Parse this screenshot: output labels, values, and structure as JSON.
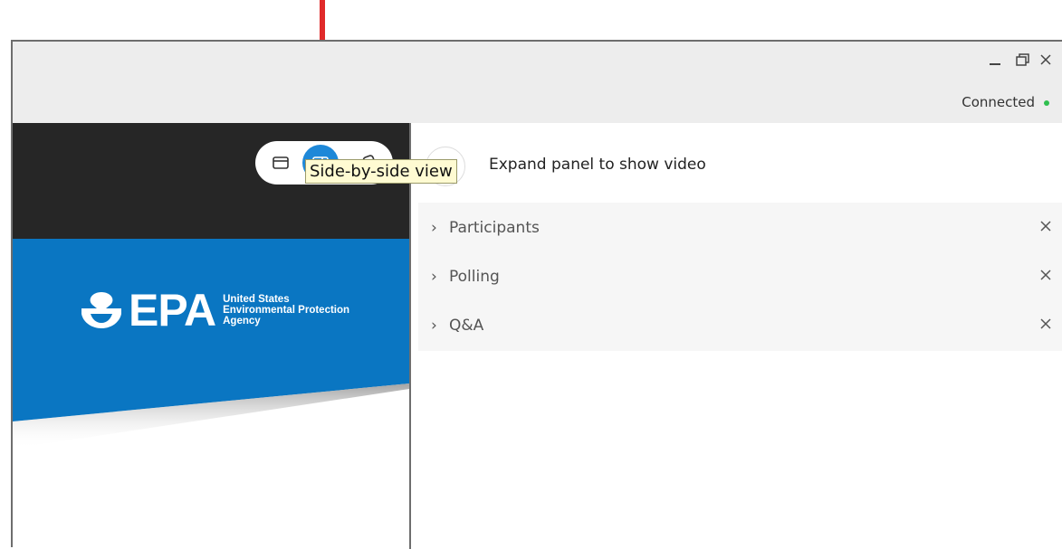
{
  "window": {
    "status_text": "Connected",
    "status_color": "#2fbf4f"
  },
  "view_toggle": {
    "tooltip": "Side-by-side view",
    "active_color": "#1e88d8"
  },
  "slide": {
    "logo_wordmark": "EPA",
    "logo_subtitle": [
      "United States",
      "Environmental Protection",
      "Agency"
    ],
    "brand_color": "#0a76c2"
  },
  "right_panel": {
    "expand_label": "Expand panel to show video",
    "panels": [
      {
        "label": "Participants"
      },
      {
        "label": "Polling"
      },
      {
        "label": "Q&A"
      }
    ]
  },
  "annotation": {
    "arrow_color": "#e02a2a"
  }
}
